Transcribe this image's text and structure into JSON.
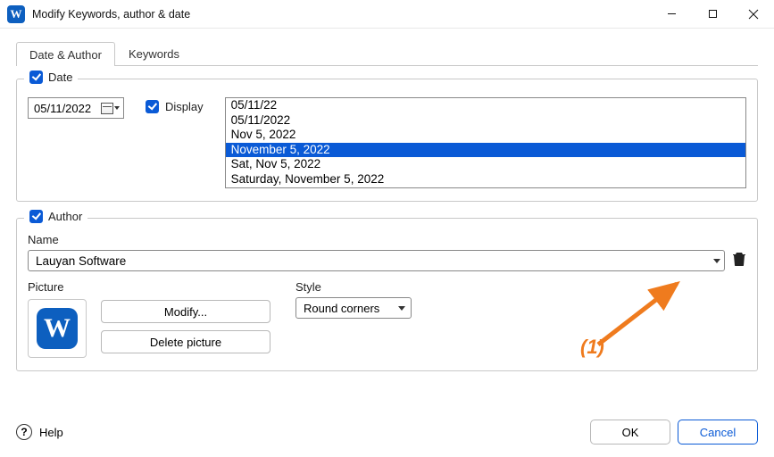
{
  "window": {
    "title": "Modify Keywords, author & date"
  },
  "tabs": {
    "date_author": "Date & Author",
    "keywords": "Keywords"
  },
  "date_section": {
    "checkbox_label": "Date",
    "date_value": "05/11/2022",
    "display_label": "Display",
    "formats": [
      "05/11/22",
      "05/11/2022",
      "Nov 5, 2022",
      "November 5, 2022",
      "Sat, Nov 5, 2022",
      "Saturday, November 5, 2022"
    ],
    "selected_index": 3
  },
  "author_section": {
    "checkbox_label": "Author",
    "name_label": "Name",
    "name_value": "Lauyan Software",
    "picture_label": "Picture",
    "modify_btn": "Modify...",
    "delete_btn": "Delete picture",
    "style_label": "Style",
    "style_value": "Round corners"
  },
  "annotation": {
    "label": "(1)"
  },
  "footer": {
    "help": "Help",
    "ok": "OK",
    "cancel": "Cancel"
  }
}
